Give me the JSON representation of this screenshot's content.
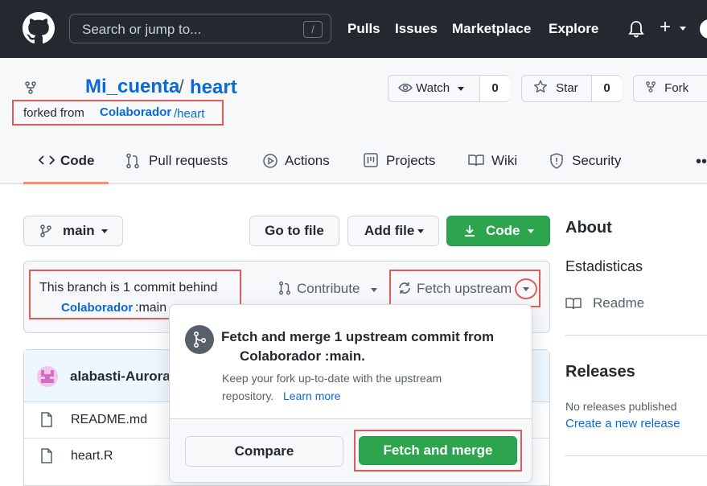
{
  "header": {
    "search_placeholder": "Search or jump to...",
    "search_shortcut": "/",
    "nav": [
      "Pulls",
      "Issues",
      "Marketplace",
      "Explore"
    ],
    "plus": "+"
  },
  "repo": {
    "owner": "Mi_cuenta",
    "separator": "/",
    "name": "heart",
    "forked_from_label": "forked from",
    "forked_owner": "Colaborador",
    "forked_repo": "/heart",
    "watch_label": "Watch",
    "watch_count": "0",
    "star_label": "Star",
    "star_count": "0",
    "fork_label": "Fork"
  },
  "tabs": [
    {
      "label": "Code",
      "icon": "code-icon"
    },
    {
      "label": "Pull requests",
      "icon": "pull-request-icon"
    },
    {
      "label": "Actions",
      "icon": "play-icon"
    },
    {
      "label": "Projects",
      "icon": "project-icon"
    },
    {
      "label": "Wiki",
      "icon": "book-icon"
    },
    {
      "label": "Security",
      "icon": "shield-icon"
    }
  ],
  "toolbar": {
    "branch": "main",
    "go_to_file": "Go to file",
    "add_file": "Add file",
    "code": "Code"
  },
  "behind": {
    "line1": "This branch is 1 commit behind",
    "owner": "Colaborador",
    "branch": ":main",
    "contribute": "Contribute",
    "fetch_upstream": "Fetch upstream"
  },
  "popover": {
    "title_line1": "Fetch and merge 1 upstream commit from",
    "title_line2": "Colaborador :main.",
    "desc_line1": "Keep your fork up-to-date with the upstream",
    "desc_line2": "repository.",
    "learn_more": "Learn more",
    "compare": "Compare",
    "fetch_merge": "Fetch and merge"
  },
  "files": {
    "commit_author": "alabasti-Aurora",
    "items": [
      "README.md",
      "heart.R"
    ]
  },
  "sidebar": {
    "about": "About",
    "description": "Estadisticas",
    "readme": "Readme",
    "releases": "Releases",
    "no_releases": "No releases published",
    "create_release": "Create a new release"
  },
  "colors": {
    "header_bg": "#24292f",
    "link": "#0969da",
    "green": "#2da44e",
    "annotation_red": "#e05a5a"
  }
}
